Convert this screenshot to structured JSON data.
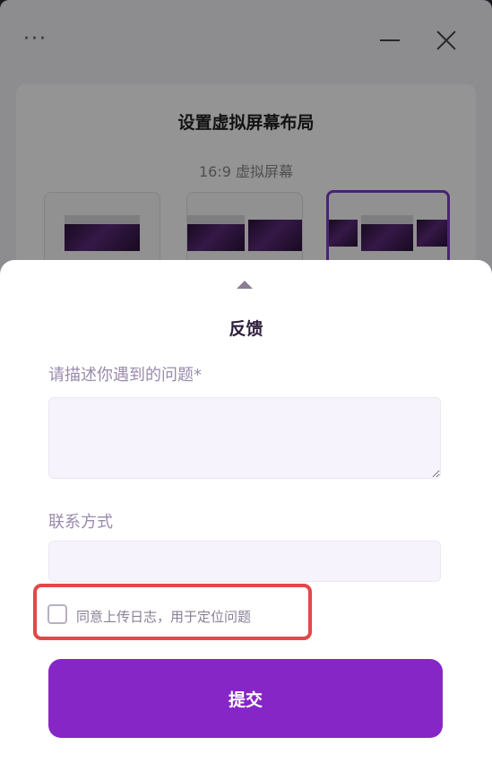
{
  "titlebar": {
    "more_icon": "more-icon",
    "minimize_icon": "minimize-icon",
    "close_icon": "close-icon"
  },
  "layout_panel": {
    "title": "设置虚拟屏幕布局",
    "subtitle": "16:9 虚拟屏幕",
    "options": [
      {
        "screens": 1,
        "selected": false
      },
      {
        "screens": 2,
        "selected": false
      },
      {
        "screens": 3,
        "selected": true
      }
    ]
  },
  "feedback": {
    "collapse_icon": "caret-up-icon",
    "title": "反馈",
    "problem_label": "请描述你遇到的问题*",
    "problem_value": "",
    "problem_placeholder": "",
    "contact_label": "联系方式",
    "contact_value": "",
    "contact_placeholder": "",
    "consent_label": "同意上传日志，用于定位问题",
    "consent_checked": false,
    "submit_label": "提交"
  },
  "colors": {
    "accent": "#8626c7",
    "highlight": "#e24848",
    "input_bg": "#f7f3fc"
  }
}
